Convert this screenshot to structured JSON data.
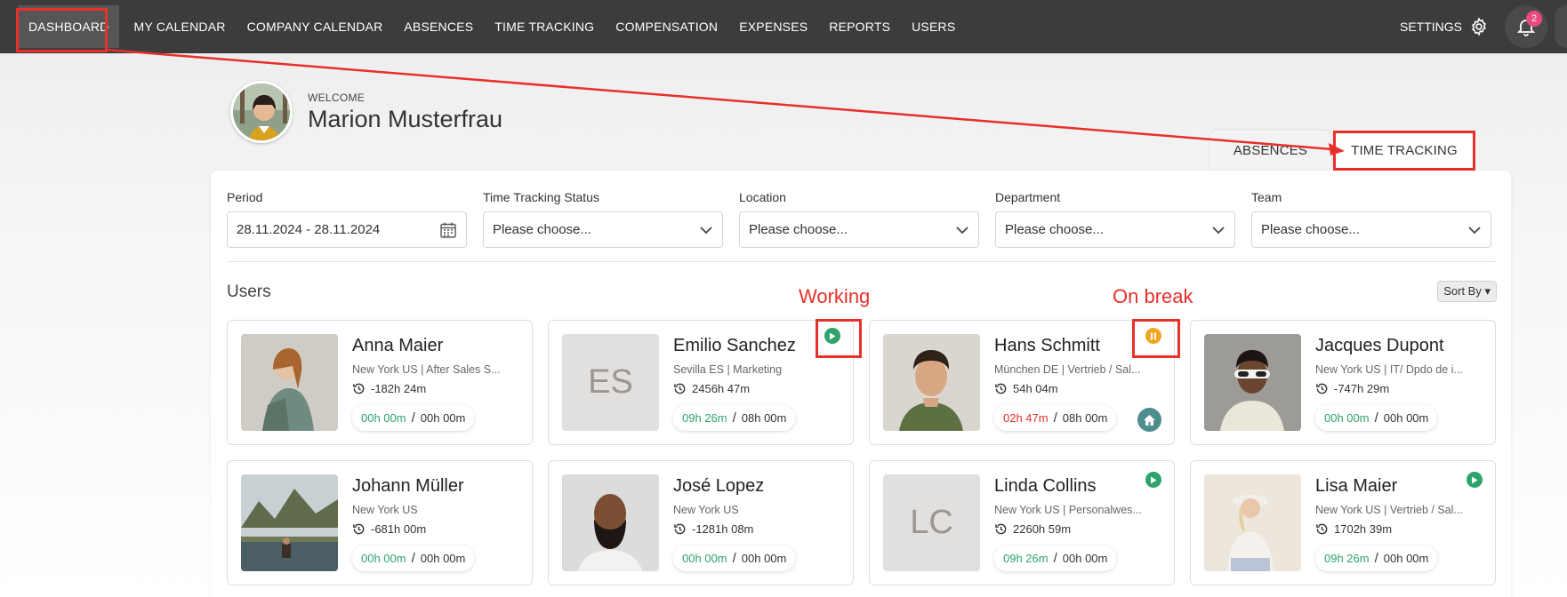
{
  "nav": {
    "items": [
      "DASHBOARD",
      "MY CALENDAR",
      "COMPANY CALENDAR",
      "ABSENCES",
      "TIME TRACKING",
      "COMPENSATION",
      "EXPENSES",
      "REPORTS",
      "USERS"
    ],
    "settings_label": "SETTINGS",
    "notification_count": "2"
  },
  "welcome": {
    "label": "WELCOME",
    "name": "Marion Musterfrau"
  },
  "tabs": [
    "ABSENCES",
    "TIME TRACKING"
  ],
  "filters": [
    {
      "label": "Period",
      "value": "28.11.2024 - 28.11.2024",
      "icon": "calendar-icon"
    },
    {
      "label": "Time Tracking Status",
      "value": "Please choose..."
    },
    {
      "label": "Location",
      "value": "Please choose..."
    },
    {
      "label": "Department",
      "value": "Please choose..."
    },
    {
      "label": "Team",
      "value": "Please choose..."
    }
  ],
  "users_title": "Users",
  "sort_label": "Sort By",
  "annotations": {
    "working": "Working",
    "on_break": "On break"
  },
  "users": [
    {
      "name": "Anna Maier",
      "location": "New York US | After Sales S...",
      "balance": "-182h 24m",
      "worked": "00h 00m",
      "target": "00h 00m",
      "status": "none"
    },
    {
      "name": "Emilio Sanchez",
      "location": "Sevilla ES | Marketing",
      "balance": "2456h 47m",
      "worked": "09h 26m",
      "target": "08h 00m",
      "status": "working",
      "initials": "ES"
    },
    {
      "name": "Hans Schmitt",
      "location": "München DE | Vertrieb / Sal...",
      "balance": "54h 04m",
      "worked": "02h 47m",
      "target": "08h 00m",
      "status": "break",
      "home": true
    },
    {
      "name": "Jacques Dupont",
      "location": "New York US | IT/ Dpdo de i...",
      "balance": "-747h 29m",
      "worked": "00h 00m",
      "target": "00h 00m",
      "status": "none"
    },
    {
      "name": "Johann Müller",
      "location": "New York US",
      "balance": "-681h 00m",
      "worked": "00h 00m",
      "target": "00h 00m",
      "status": "none"
    },
    {
      "name": "José Lopez",
      "location": "New York US",
      "balance": "-1281h 08m",
      "worked": "00h 00m",
      "target": "00h 00m",
      "status": "none"
    },
    {
      "name": "Linda Collins",
      "location": "New York US | Personalwes...",
      "balance": "2260h 59m",
      "worked": "09h 26m",
      "target": "00h 00m",
      "status": "working",
      "initials": "LC"
    },
    {
      "name": "Lisa Maier",
      "location": "New York US | Vertrieb / Sal...",
      "balance": "1702h 39m",
      "worked": "09h 26m",
      "target": "00h 00m",
      "status": "working"
    }
  ],
  "colors": {
    "nav_bg": "#3c3c3c",
    "green": "#2ea36b",
    "orange": "#f0a623",
    "red_annotation": "#e8302a",
    "badge": "#e84a7e"
  }
}
